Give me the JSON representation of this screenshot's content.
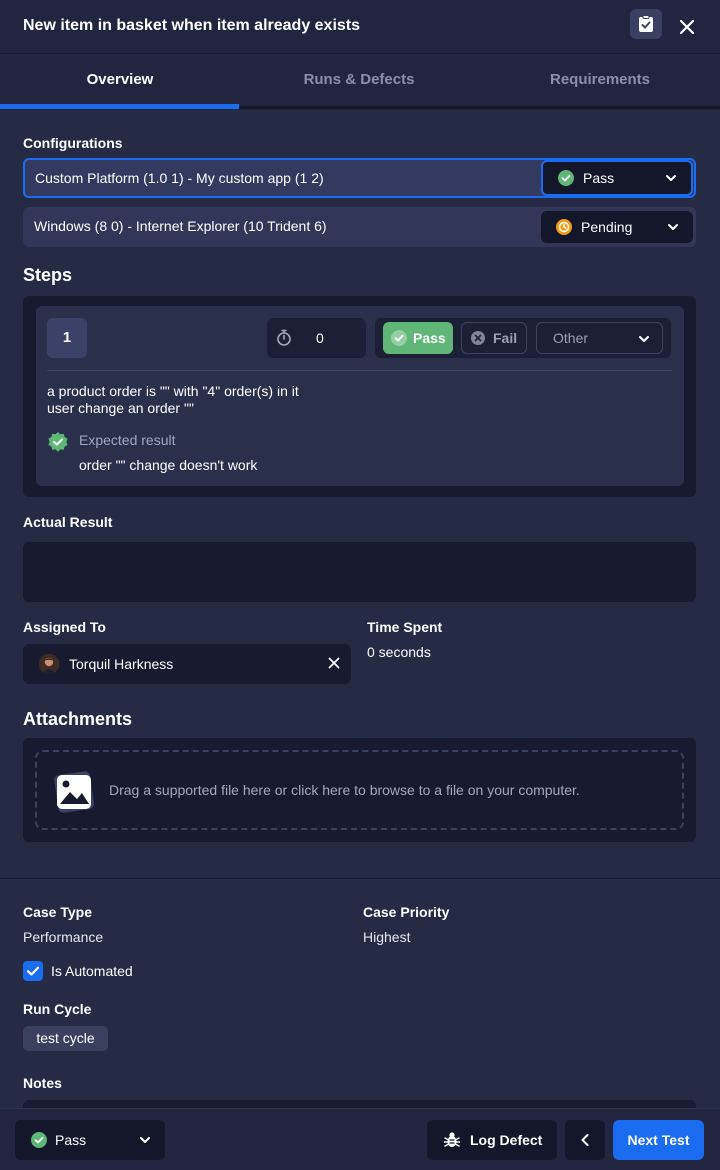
{
  "header": {
    "title": "New item in basket when item already exists"
  },
  "tabs": [
    {
      "label": "Overview"
    },
    {
      "label": "Runs & Defects"
    },
    {
      "label": "Requirements"
    }
  ],
  "configurations": {
    "label": "Configurations",
    "rows": [
      {
        "label": "Custom Platform (1.0 1) - My custom app (1 2)",
        "status": "Pass",
        "status_color": "#5fb677"
      },
      {
        "label": "Windows (8 0) - Internet Explorer (10 Trident 6)",
        "status": "Pending",
        "status_color": "#f29d1c"
      }
    ]
  },
  "steps": {
    "label": "Steps",
    "step_number": "1",
    "timer_value": "0",
    "pass_label": "Pass",
    "fail_label": "Fail",
    "other_label": "Other",
    "line1": "a product order is \"\" with \"4\" order(s) in it",
    "line2": "user change an order \"\"",
    "expected_label": "Expected result",
    "expected_text": "order \"\" change doesn't work"
  },
  "actual_result": {
    "label": "Actual Result"
  },
  "assigned_to": {
    "label": "Assigned To",
    "name": "Torquil Harkness"
  },
  "time_spent": {
    "label": "Time Spent",
    "value": "0 seconds"
  },
  "attachments": {
    "label": "Attachments",
    "drop_text": "Drag a supported file here or click here to browse to a file on your computer."
  },
  "details": {
    "case_type_label": "Case Type",
    "case_type_value": "Performance",
    "case_priority_label": "Case Priority",
    "case_priority_value": "Highest",
    "automated_label": "Is Automated",
    "automated_checked": true,
    "run_cycle_label": "Run Cycle",
    "run_cycle_value": "test cycle",
    "notes_label": "Notes"
  },
  "footer": {
    "status": "Pass",
    "log_defect_label": "Log Defect",
    "next_label": "Next Test"
  },
  "colors": {
    "accent": "#1a6cf0",
    "pass": "#5fb677",
    "pending": "#f29d1c"
  }
}
